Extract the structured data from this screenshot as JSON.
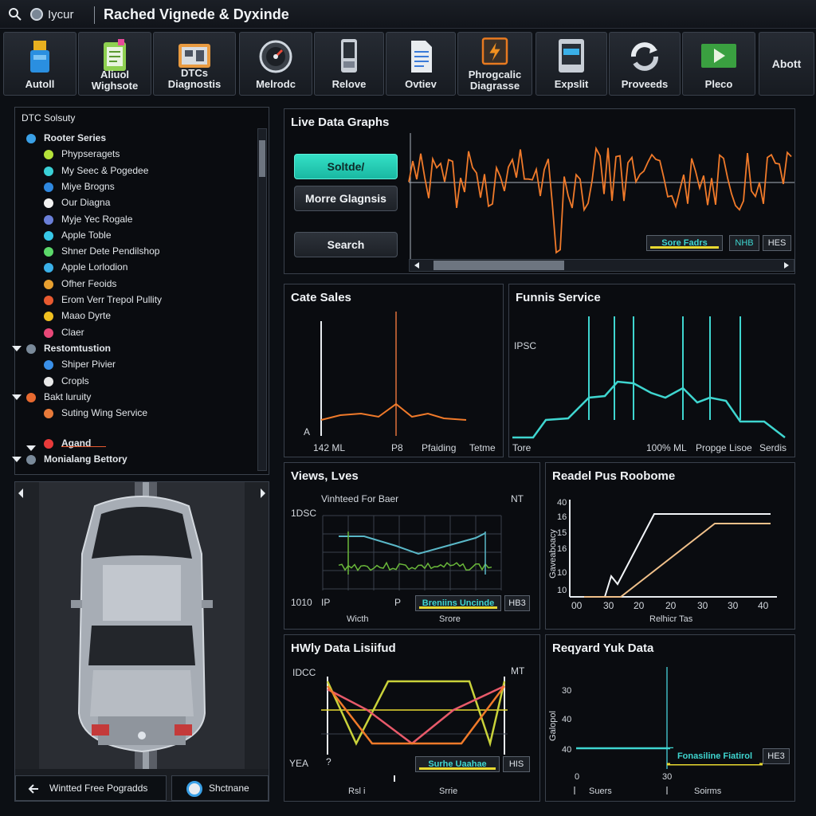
{
  "titlebar": {
    "app_name": "Iycur",
    "window_title": "Rached Vignede & Dyxinde"
  },
  "toolbar": {
    "items": [
      {
        "label": "Autoll",
        "icon": "usb-drive-icon"
      },
      {
        "label": "Aliuol\nWighsote",
        "icon": "clipboard-icon"
      },
      {
        "label": "DTCs Diagnostis",
        "icon": "dtc-scanner-icon"
      },
      {
        "label": "Melrodc",
        "icon": "gauge-icon"
      },
      {
        "label": "Relove",
        "icon": "device-icon"
      },
      {
        "label": "Ovtiev",
        "icon": "document-icon"
      },
      {
        "label": "Phrogcalic\nDiagrasse",
        "icon": "lightning-icon"
      },
      {
        "label": "Expslit",
        "icon": "monitor-icon"
      },
      {
        "label": "Proveeds",
        "icon": "refresh-icon"
      },
      {
        "label": "Pleco",
        "icon": "play-icon"
      },
      {
        "label": "Abott",
        "icon": ""
      }
    ]
  },
  "tree": {
    "title": "DTC Solsuty",
    "items": [
      {
        "label": "Rooter Series",
        "bold": true,
        "color": "#3aa0e6",
        "level": 0
      },
      {
        "label": "Phypseragets",
        "color": "#b5e23a",
        "level": 1
      },
      {
        "label": "My Seec & Pogedee",
        "color": "#3ad0d6",
        "level": 1
      },
      {
        "label": "Miye Brogns",
        "color": "#2f88e0",
        "level": 1
      },
      {
        "label": "Our Diagna",
        "color": "#f2f2f2",
        "level": 1
      },
      {
        "label": "Myje Yec Rogale",
        "color": "#6a7fd8",
        "level": 1
      },
      {
        "label": "Apple Toble",
        "color": "#38c8e8",
        "level": 1
      },
      {
        "label": "Shner Dete Pendilshop",
        "color": "#5cd86a",
        "level": 1
      },
      {
        "label": "Apple Lorlodion",
        "color": "#3ab0e8",
        "level": 1
      },
      {
        "label": "Ofher Feoids",
        "color": "#e8a030",
        "level": 1
      },
      {
        "label": "Erom Verr Trepol Pullity",
        "color": "#e85a30",
        "level": 1
      },
      {
        "label": "Maao Dyrte",
        "color": "#f0c020",
        "level": 1
      },
      {
        "label": "Claer",
        "color": "#e84878",
        "level": 1
      },
      {
        "label": "Restomtustion",
        "bold": true,
        "color": "#7a8a9a",
        "level": 0,
        "caret": true
      },
      {
        "label": "Shiper Pivier",
        "color": "#3a90e8",
        "level": 1
      },
      {
        "label": "Cropls",
        "color": "#e8e8e8",
        "level": 1
      },
      {
        "label": "Bakt luruity",
        "color": "#e86a30",
        "level": 0,
        "caret": true
      },
      {
        "label": "Suting Wing Service",
        "color": "#e87a3a",
        "level": 1
      },
      {
        "label": "Agand",
        "bold": true,
        "color": "#e83a3a",
        "level": 1
      },
      {
        "label": "Monialang Bettory",
        "bold": true,
        "color": "#7a8a9a",
        "level": 0,
        "caret": true
      }
    ]
  },
  "car_view": {
    "footer_left": "Wintted Free Pogradds",
    "footer_right": "Shctnane"
  },
  "live": {
    "title": "Live Data Graphs",
    "btn_primary": "Soltde/",
    "btn_more": "Morre Glagnsis",
    "btn_search": "Search",
    "legend_main": "Sore Fadrs",
    "legend_mid": "NHB",
    "legend_small": "HES",
    "accent": "#f07a2a"
  },
  "cate_sales": {
    "title": "Cate Sales",
    "x_labels": [
      "142 ML",
      "P8",
      "Pfaiding",
      "Tetme"
    ],
    "y_label": "A"
  },
  "funnis": {
    "title": "Funnis Service",
    "y_label": "IPSC",
    "x_labels": [
      "Tore",
      "100% ML",
      "Propge Lisoe",
      "Serdis"
    ]
  },
  "views": {
    "title": "Views, Lves",
    "subtitle": "Vinhteed For Baer",
    "right_tag": "NT",
    "y_label": "1DSC",
    "bottom_left": "1010",
    "bottom_a": "IP",
    "bottom_b": "P",
    "x_label_a": "Wicth",
    "x_label_b": "Srore",
    "legend_main": "Breniins Uncinde",
    "legend_small": "HB3"
  },
  "readel": {
    "title": "Readel Pus Roobome",
    "y_ticks": [
      "40",
      "16",
      "15",
      "16",
      "10",
      "10"
    ],
    "y_axis_label": "Gaveaboacy",
    "x_ticks": [
      "00",
      "30",
      "20",
      "20",
      "30",
      "30",
      "40"
    ],
    "x_label": "Relhicr Tas"
  },
  "hwly": {
    "title": "HWly Data Lisiifud",
    "y_label": "IDCC",
    "right_tag": "MT",
    "bottom_left": "YEA",
    "bottom_q": "?",
    "x_label_a": "Rsl i",
    "x_label_b": "Srrie",
    "legend_main": "Surhe Uaahae",
    "legend_small": "HIS"
  },
  "reqyard": {
    "title": "Reqyard Yuk Data",
    "y_ticks": [
      "30",
      "40",
      "40"
    ],
    "y_axis_label": "Galopol",
    "x_ticks": [
      "0",
      "30"
    ],
    "x_label_a": "Suers",
    "x_label_b": "Soirms",
    "legend_main": "Fonasiline Fiatirol",
    "legend_small": "HE3"
  }
}
